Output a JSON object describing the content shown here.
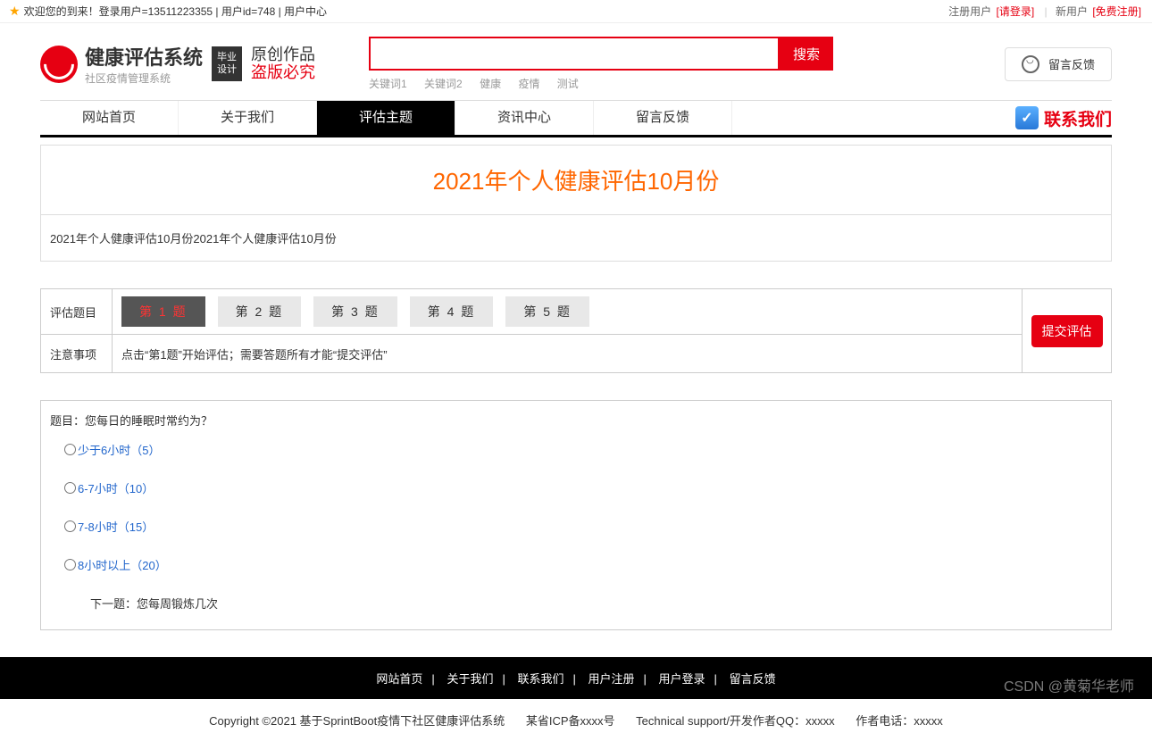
{
  "topbar": {
    "welcome": "欢迎您的到来！登录用户=13511223355 | 用户id=748 | 用户中心",
    "reg_user": "注册用户",
    "login": "[请登录]",
    "new_user": "新用户",
    "free_reg": "[免费注册]"
  },
  "logo": {
    "title": "健康评估系统",
    "subtitle": "社区疫情管理系统",
    "badge_l1": "毕业",
    "badge_l2": "设计",
    "script_l1": "原创作品",
    "script_l2": "盗版必究"
  },
  "search": {
    "button": "搜索",
    "keywords": [
      "关键词1",
      "关键词2",
      "健康",
      "疫情",
      "测试"
    ]
  },
  "feedback_btn": "留言反馈",
  "nav": {
    "items": [
      "网站首页",
      "关于我们",
      "评估主题",
      "资讯中心",
      "留言反馈"
    ],
    "active_index": 2,
    "contact": "联系我们"
  },
  "page": {
    "title": "2021年个人健康评估10月份",
    "desc": "2021年个人健康评估10月份2021年个人健康评估10月份"
  },
  "eval": {
    "label_q": "评估题目",
    "label_note": "注意事项",
    "questions": [
      "第 1 题",
      "第 2 题",
      "第 3 题",
      "第 4 题",
      "第 5 题"
    ],
    "active_q": 0,
    "note": "点击“第1题”开始评估；需要答题所有才能“提交评估”",
    "submit": "提交评估"
  },
  "question": {
    "title": "题目：您每日的睡眠时常约为？",
    "options": [
      "少于6小时（5）",
      "6-7小时（10）",
      "7-8小时（15）",
      "8小时以上（20）"
    ],
    "next": "下一题：您每周锻炼几次"
  },
  "footer": {
    "links": [
      "网站首页",
      "关于我们",
      "联系我们",
      "用户注册",
      "用户登录",
      "留言反馈"
    ],
    "copyright": "Copyright ©2021 基于SprintBoot疫情下社区健康评估系统",
    "icp": "某省ICP备xxxx号",
    "tech": "Technical support/开发作者QQ：xxxxx",
    "phone": "作者电话：xxxxx"
  },
  "watermark": "CSDN @黄菊华老师"
}
